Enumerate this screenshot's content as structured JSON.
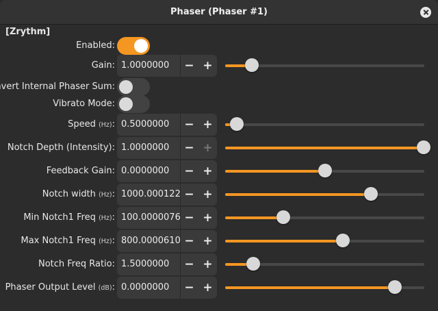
{
  "window": {
    "title": "Phaser (Phaser #1)"
  },
  "section_title": "[Zrythm]",
  "colors": {
    "accent": "#f49622",
    "track": "#484848",
    "background": "#2c2c2c"
  },
  "toggles": [
    {
      "id": "enabled",
      "label": "Enabled:",
      "on": true
    },
    {
      "id": "invert",
      "label": "Invert Internal Phaser Sum:",
      "on": false
    },
    {
      "id": "vibrato",
      "label": "Vibrato Mode:",
      "on": false
    }
  ],
  "params": {
    "gain": {
      "label": "Gain:",
      "unit": "",
      "value": "1.0000000",
      "fraction": 0.13,
      "minus": "−",
      "plus": "+"
    },
    "speed": {
      "label": "Speed",
      "unit": "(Hz)",
      "value": "0.5000000",
      "fraction": 0.055,
      "minus": "−",
      "plus": "+"
    },
    "notch_depth": {
      "label": "Notch Depth (Intensity):",
      "unit": "",
      "value": "1.0000000",
      "fraction": 1.0,
      "minus": "−",
      "plus": "+",
      "plus_disabled": true
    },
    "feedback": {
      "label": "Feedback Gain:",
      "unit": "",
      "value": "0.0000000",
      "fraction": 0.5,
      "minus": "−",
      "plus": "+"
    },
    "notch_width": {
      "label": "Notch width",
      "unit": "(Hz)",
      "value": "1000.0001221",
      "fraction": 0.735,
      "minus": "−",
      "plus": "+"
    },
    "min_notch": {
      "label": "Min Notch1 Freq",
      "unit": "(Hz)",
      "value": "100.0000076",
      "fraction": 0.29,
      "minus": "−",
      "plus": "+"
    },
    "max_notch": {
      "label": "Max Notch1 Freq",
      "unit": "(Hz)",
      "value": "800.0000610",
      "fraction": 0.59,
      "minus": "−",
      "plus": "+"
    },
    "notch_ratio": {
      "label": "Notch Freq Ratio:",
      "unit": "",
      "value": "1.5000000",
      "fraction": 0.14,
      "minus": "−",
      "plus": "+"
    },
    "output_level": {
      "label": "Phaser Output Level",
      "unit": "(dB)",
      "value": "0.0000000",
      "fraction": 0.855,
      "minus": "−",
      "plus": "+"
    }
  },
  "suffix_colon": ":"
}
